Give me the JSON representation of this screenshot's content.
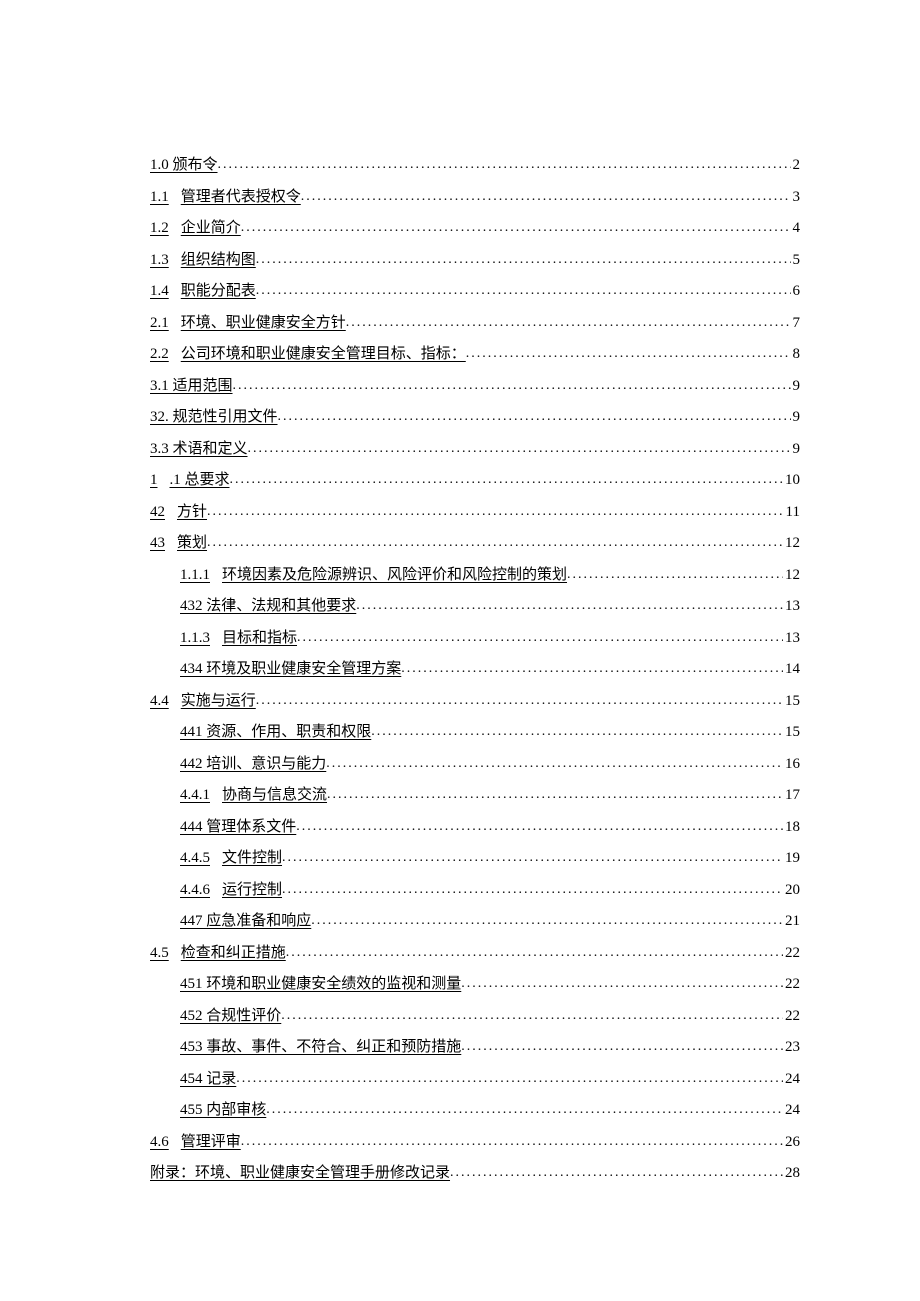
{
  "toc": [
    {
      "indent": 0,
      "num": "1.0",
      "label": "颁布令",
      "page": "2",
      "combined": true
    },
    {
      "indent": 0,
      "num": "1.1",
      "label": "管理者代表授权令",
      "page": "3",
      "combined": false
    },
    {
      "indent": 0,
      "num": "1.2",
      "label": "企业简介",
      "page": "4",
      "combined": false
    },
    {
      "indent": 0,
      "num": "1.3",
      "label": "组织结构图",
      "page": "5",
      "combined": false
    },
    {
      "indent": 0,
      "num": "1.4",
      "label": "职能分配表",
      "page": "6",
      "combined": false
    },
    {
      "indent": 0,
      "num": "2.1",
      "label": "环境、职业健康安全方针",
      "page": "7",
      "combined": false
    },
    {
      "indent": 0,
      "num": "2.2",
      "label": "公司环境和职业健康安全管理目标、指标：",
      "page": "8",
      "combined": false
    },
    {
      "indent": 0,
      "num": "",
      "label": "3.1 适用范围",
      "page": "9",
      "combined": true
    },
    {
      "indent": 0,
      "num": "",
      "label": "32. 规范性引用文件",
      "page": "9",
      "combined": true
    },
    {
      "indent": 0,
      "num": "",
      "label": "3.3 术语和定义",
      "page": "9",
      "combined": true
    },
    {
      "indent": 0,
      "num": "1",
      "label": ".1 总要求",
      "page": "10",
      "combined": false
    },
    {
      "indent": 0,
      "num": "42",
      "label": "方针",
      "page": "11",
      "combined": false
    },
    {
      "indent": 0,
      "num": "43",
      "label": "策划",
      "page": "12",
      "combined": false
    },
    {
      "indent": 1,
      "num": "1.1.1",
      "label": "环境因素及危险源辨识、风险评价和风险控制的策划",
      "page": "12",
      "combined": false
    },
    {
      "indent": 1,
      "num": "",
      "label": "432 法律、法规和其他要求",
      "page": "13",
      "combined": true
    },
    {
      "indent": 1,
      "num": "1.1.3",
      "label": "目标和指标",
      "page": "13",
      "combined": false
    },
    {
      "indent": 1,
      "num": "",
      "label": "434 环境及职业健康安全管理方案",
      "page": "14",
      "combined": true
    },
    {
      "indent": 0,
      "num": "4.4",
      "label": "实施与运行",
      "page": "15",
      "combined": false
    },
    {
      "indent": 1,
      "num": "",
      "label": "441 资源、作用、职责和权限",
      "page": "15",
      "combined": true
    },
    {
      "indent": 1,
      "num": "",
      "label": "442 培训、意识与能力",
      "page": "16",
      "combined": true
    },
    {
      "indent": 1,
      "num": "4.4.1",
      "label": "协商与信息交流",
      "page": "17",
      "combined": false
    },
    {
      "indent": 1,
      "num": "",
      "label": "444 管理体系文件",
      "page": "18",
      "combined": true
    },
    {
      "indent": 1,
      "num": "4.4.5",
      "label": "文件控制",
      "page": "19",
      "combined": false
    },
    {
      "indent": 1,
      "num": "4.4.6",
      "label": "运行控制",
      "page": "20",
      "combined": false
    },
    {
      "indent": 1,
      "num": "",
      "label": "447 应急准备和响应",
      "page": "21",
      "combined": true
    },
    {
      "indent": 0,
      "num": "4.5",
      "label": "检查和纠正措施",
      "page": "22",
      "combined": false
    },
    {
      "indent": 1,
      "num": "",
      "label": "451 环境和职业健康安全绩效的监视和测量",
      "page": "22",
      "combined": true
    },
    {
      "indent": 1,
      "num": "",
      "label": "452 合规性评价",
      "page": "22",
      "combined": true
    },
    {
      "indent": 1,
      "num": "",
      "label": "453 事故、事件、不符合、纠正和预防措施",
      "page": "23",
      "combined": true
    },
    {
      "indent": 1,
      "num": "",
      "label": "454 记录",
      "page": "24",
      "combined": true
    },
    {
      "indent": 1,
      "num": "",
      "label": "455 内部审核",
      "page": "24",
      "combined": true
    },
    {
      "indent": 0,
      "num": "4.6",
      "label": "管理评审",
      "page": "26",
      "combined": false
    },
    {
      "indent": 0,
      "num": "",
      "label": "附录：环境、职业健康安全管理手册修改记录",
      "page": "28",
      "combined": true
    }
  ]
}
